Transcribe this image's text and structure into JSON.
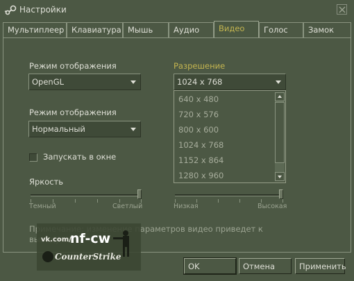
{
  "window": {
    "title": "Настройки"
  },
  "tabs": [
    {
      "label": "Мультиплеер"
    },
    {
      "label": "Клавиатура"
    },
    {
      "label": "Мышь"
    },
    {
      "label": "Аудио"
    },
    {
      "label": "Видео",
      "active": true
    },
    {
      "label": "Голос"
    },
    {
      "label": "Замок"
    }
  ],
  "video": {
    "renderer": {
      "label": "Режим отображения",
      "value": "OpenGL"
    },
    "display_mode": {
      "label": "Режим отображения",
      "value": "Нормальный"
    },
    "windowed": {
      "label": "Запускать в окне",
      "checked": false
    },
    "brightness": {
      "label": "Яркость",
      "min_label": "Темный",
      "max_label": "Светлый",
      "level": 1.0
    },
    "gamma": {
      "min_label": "Низкая",
      "max_label": "Высокая",
      "level": 1.0
    },
    "resolution": {
      "label": "Разрешение",
      "value": "1024 x 768",
      "options": [
        "640 x 480",
        "720 x 576",
        "800 x 600",
        "1024 x 768",
        "1152 x 864",
        "1280 x 960"
      ]
    },
    "note": "Примечание: изменение параметров видео приведет к выходу из"
  },
  "buttons": {
    "ok": "OK",
    "cancel": "Отмена",
    "apply": "Применить"
  },
  "watermark": {
    "line1": "vk.com/",
    "brand": "nf-cw",
    "game": "CounterStrike"
  },
  "colors": {
    "background": "#4c5844",
    "accent": "#c4b550",
    "text": "#dedfd6"
  }
}
